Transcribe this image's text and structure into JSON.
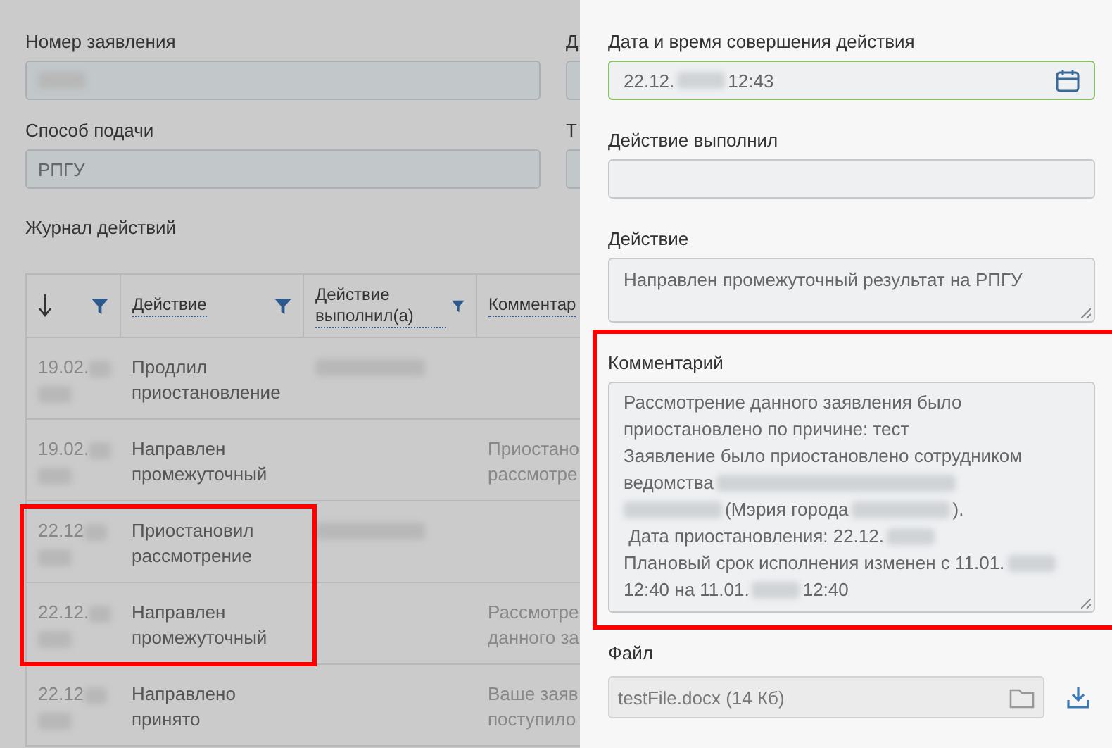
{
  "form": {
    "fields": [
      {
        "label": "Номер заявления",
        "value": [
          {
            "kind": "blur-s"
          }
        ]
      },
      {
        "label": "Способ подачи",
        "value": [
          {
            "kind": "text",
            "text": "РПГУ"
          }
        ]
      }
    ],
    "cut_labels": [
      "Д",
      "Т"
    ]
  },
  "journal": {
    "title": "Журнал действий",
    "columns": [
      {
        "sorted": true,
        "filter": true
      },
      {
        "label": "Действие",
        "sorted": false,
        "filter": true
      },
      {
        "label": "Действие выполнил(а)",
        "sorted": false,
        "filter": true
      },
      {
        "label": "Комментар",
        "sorted": false,
        "filter": false
      }
    ],
    "rows": [
      {
        "date": "19.02.",
        "action": "Продлил приостановление",
        "performer_redacted": true,
        "comment": []
      },
      {
        "date": "19.02.",
        "action": "Направлен промежуточный",
        "performer_redacted": false,
        "comment": [
          "Приостано",
          "рассмотре"
        ]
      },
      {
        "date": "22.12",
        "action": "Приостановил рассмотрение",
        "performer_redacted": true,
        "comment": [],
        "highlighted": true
      },
      {
        "date": "22.12.",
        "action": "Направлен промежуточный",
        "performer_redacted": false,
        "comment": [
          "Рассмотре",
          "данного за"
        ],
        "highlighted": true
      },
      {
        "date": "22.12",
        "action": "Направлено принято",
        "performer_redacted": false,
        "comment": [
          "Ваше заяв",
          "поступило"
        ]
      }
    ]
  },
  "detail": {
    "datetime": {
      "label": "Дата и время совершения действия",
      "value": [
        {
          "kind": "text",
          "text": "22.12."
        },
        {
          "kind": "blur-s"
        },
        {
          "kind": "text",
          "text": "12:43"
        }
      ]
    },
    "performer": {
      "label": "Действие выполнил"
    },
    "action": {
      "label": "Действие",
      "value": "Направлен промежуточный результат на РПГУ"
    },
    "comment": {
      "label": "Комментарий",
      "highlighted": true,
      "lines": [
        [
          {
            "kind": "text",
            "text": "Рассмотрение данного заявления было"
          }
        ],
        [
          {
            "kind": "text",
            "text": "приостановлено по причине: тест"
          }
        ],
        [
          {
            "kind": "text",
            "text": "Заявление было приостановлено сотрудником"
          }
        ],
        [
          {
            "kind": "text",
            "text": "ведомства"
          },
          {
            "kind": "blur-l"
          }
        ],
        [
          {
            "kind": "blur-m"
          },
          {
            "kind": "text",
            "text": "(Мэрия города"
          },
          {
            "kind": "blur-m"
          },
          {
            "kind": "text",
            "text": ")."
          }
        ],
        [
          {
            "kind": "text",
            "text": " Дата приостановления: 22.12."
          },
          {
            "kind": "blur-s"
          }
        ],
        [
          {
            "kind": "text",
            "text": "Плановый срок исполнения изменен с 11.01."
          },
          {
            "kind": "blur-s"
          }
        ],
        [
          {
            "kind": "text",
            "text": "12:40 на 11.01."
          },
          {
            "kind": "blur-s"
          },
          {
            "kind": "text",
            "text": "12:40"
          }
        ]
      ]
    },
    "file": {
      "label": "Файл",
      "value": "testFile.docx (14 Кб)"
    }
  }
}
